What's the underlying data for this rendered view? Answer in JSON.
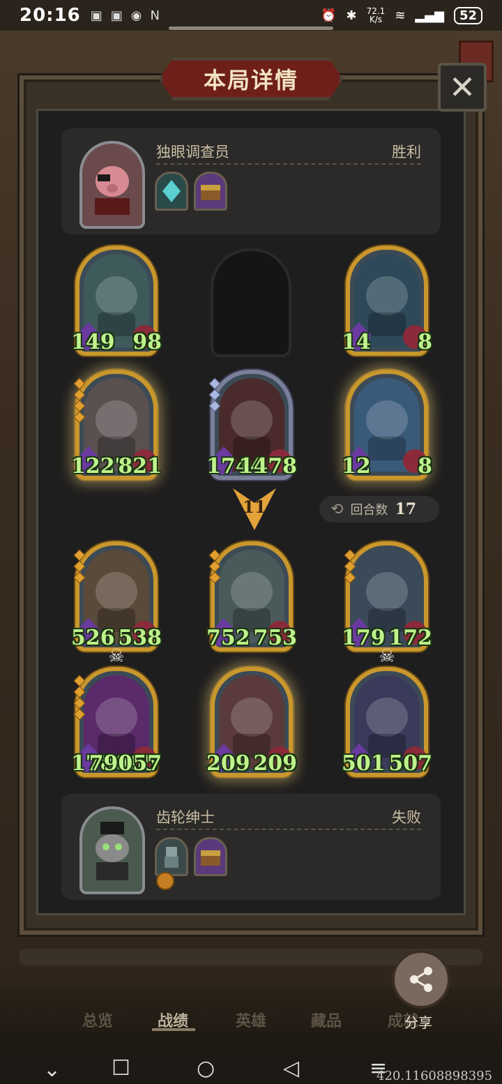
{
  "status_bar": {
    "time": "20:16",
    "net_speed": "72.1",
    "net_unit": "K/s",
    "battery": "52"
  },
  "dialog": {
    "title": "本局详情",
    "close_icon": "close-icon"
  },
  "winner": {
    "name": "独眼调查员",
    "result": "胜利",
    "hero_icon": "pig-pirate-hero",
    "items": [
      "crystal-shard-item",
      "treasure-chest-item"
    ]
  },
  "loser": {
    "name": "齿轮绅士",
    "result": "失败",
    "hero_icon": "gear-gentleman-hero",
    "items": [
      "robot-item",
      "treasure-chest-item"
    ],
    "extra_icon": "coin-icon"
  },
  "top_board": [
    {
      "atk": "149",
      "hp": "98",
      "art": "sea-monster",
      "art_color": "#3e5a5a",
      "style": "normal",
      "pips": 0
    },
    {
      "empty": true
    },
    {
      "atk": "14",
      "hp": "8",
      "art": "bard",
      "art_color": "#2e4a5a",
      "style": "normal",
      "pips": 0
    },
    {
      "atk": "1227",
      "hp": "821",
      "art": "dragon",
      "art_color": "#5a5050",
      "style": "gold",
      "pips": 4
    },
    {
      "atk": "1744",
      "hp": "1478",
      "art": "red-dragon",
      "art_color": "#4a2a2a",
      "style": "silver",
      "pips": 3
    },
    {
      "atk": "12",
      "hp": "8",
      "art": "armored-knight",
      "art_color": "#3a5a7a",
      "style": "gold",
      "pips": 0
    }
  ],
  "middle": {
    "attack_count": "11",
    "turns_label": "回合数",
    "turns_value": "17",
    "turns_icon": "refresh-icon",
    "arrow_icon": "attack-arrow-icon"
  },
  "bottom_board": [
    {
      "atk": "526",
      "hp": "538",
      "art": "flower-witch",
      "art_color": "#5a4a3a",
      "style": "normal",
      "pips": 3,
      "dead": true
    },
    {
      "atk": "752",
      "hp": "753",
      "art": "airship",
      "art_color": "#4a5a5a",
      "style": "normal",
      "pips": 3,
      "dead": false
    },
    {
      "atk": "179",
      "hp": "172",
      "art": "mech-golem",
      "art_color": "#3a4a5a",
      "style": "normal",
      "pips": 3,
      "dead": true
    },
    {
      "atk": "178005",
      "hp": "79057",
      "art": "stone-beast",
      "art_color": "#5a2a6a",
      "style": "normal",
      "pips": 4,
      "dead": false
    },
    {
      "atk": "209",
      "hp": "209",
      "art": "clown",
      "art_color": "#5a3a3a",
      "style": "gold",
      "pips": 0,
      "dead": false
    },
    {
      "atk": "501",
      "hp": "507",
      "art": "elf-sorceress",
      "art_color": "#3a3a5a",
      "style": "normal",
      "pips": 0,
      "dead": false
    }
  ],
  "tabs": {
    "overview": "总览",
    "record": "战绩",
    "heroes": "英雄",
    "collection": "藏品",
    "achievements": "成就"
  },
  "share": {
    "label": "分享",
    "icon": "share-icon"
  },
  "watermark": "420.11608898395",
  "skull_icon": "skull-icon"
}
